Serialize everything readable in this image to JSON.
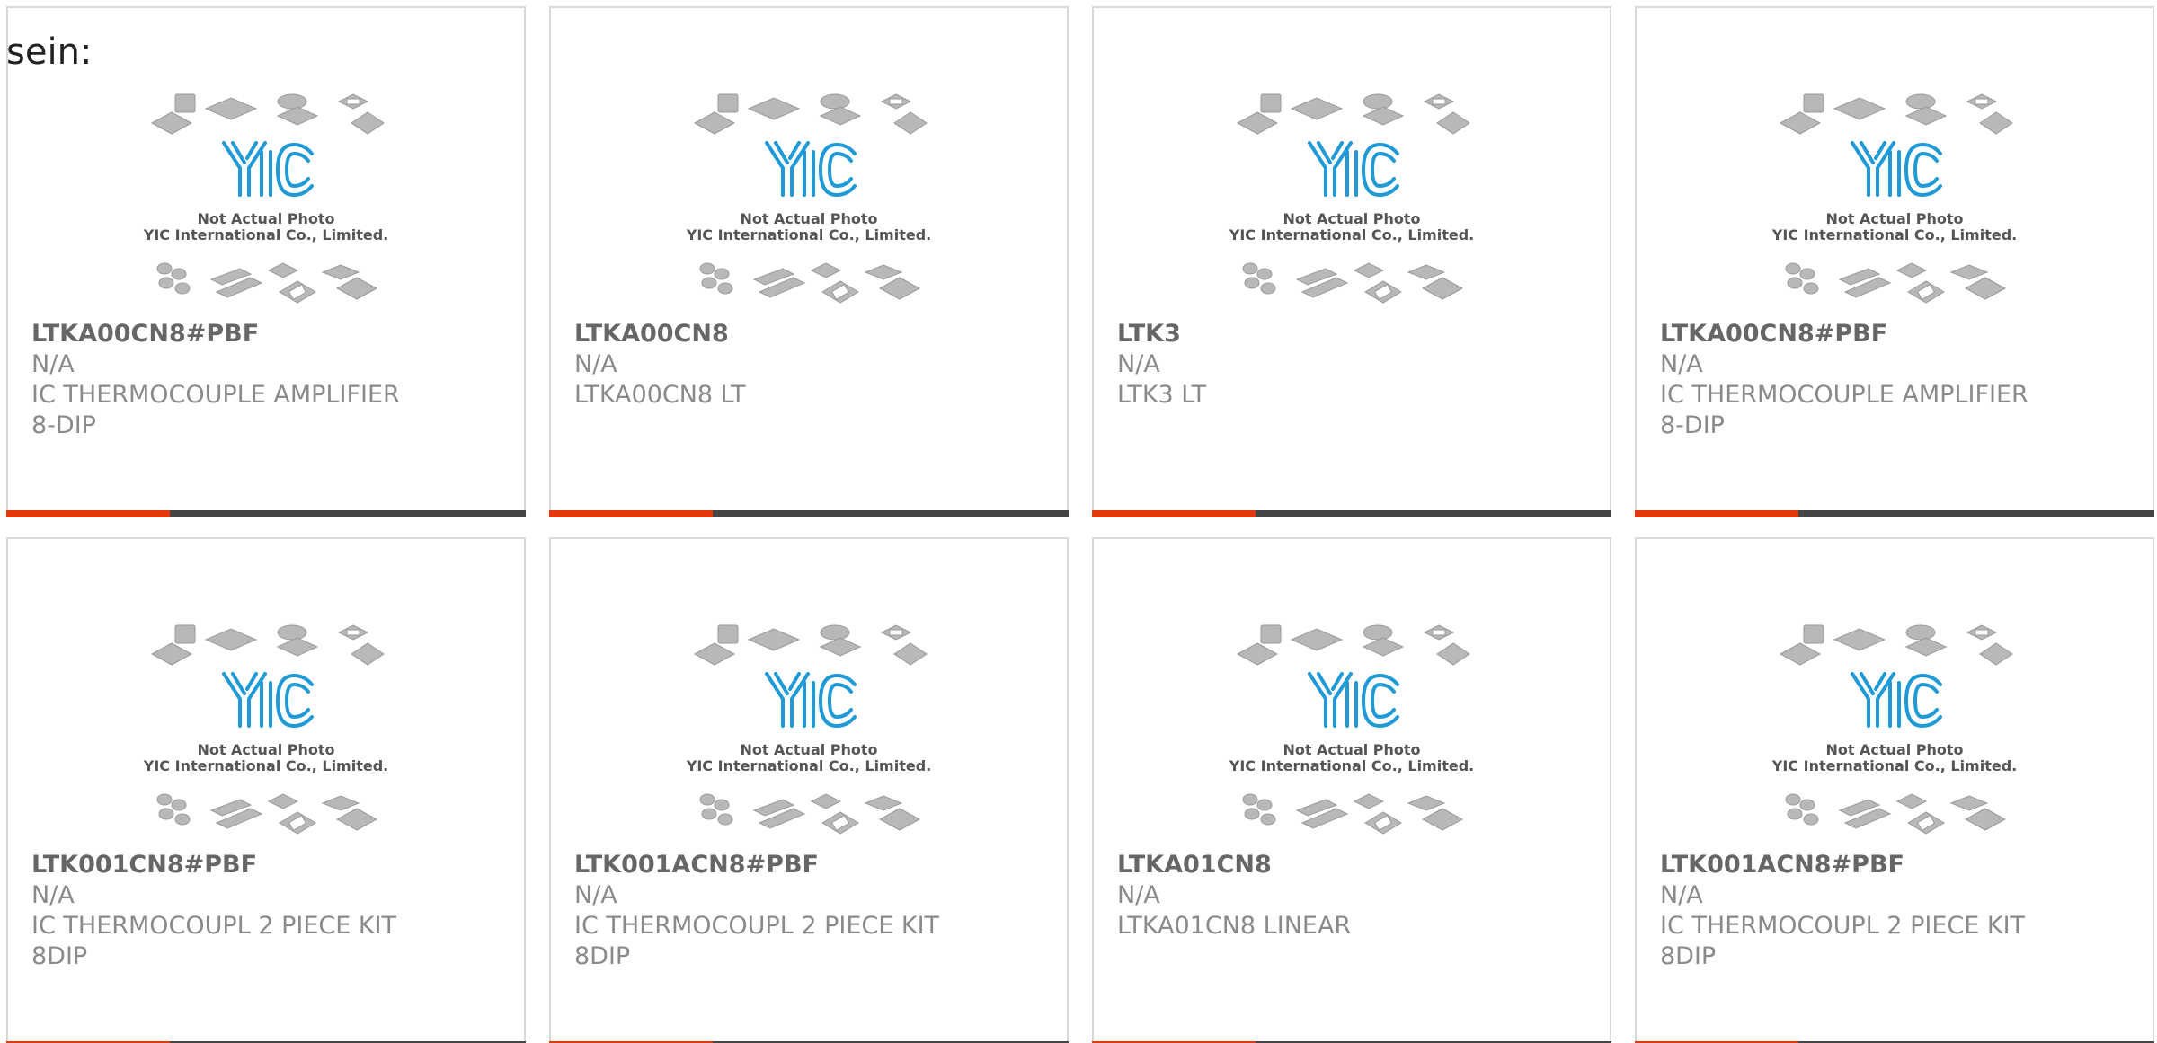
{
  "lead_text": "sein:",
  "accent_color": "#e5380f",
  "bar_color": "#454545",
  "placeholder": {
    "brand": "YIC",
    "line1": "Not Actual Photo",
    "line2": "YIC International Co., Limited."
  },
  "products": [
    {
      "part": "LTKA00CN8#PBF",
      "manufacturer": "N/A",
      "description": [
        "IC THERMOCOUPLE AMPLIFIER",
        "8-DIP"
      ]
    },
    {
      "part": "LTKA00CN8",
      "manufacturer": "N/A",
      "description": [
        "LTKA00CN8 LT"
      ]
    },
    {
      "part": "LTK3",
      "manufacturer": "N/A",
      "description": [
        "LTK3 LT"
      ]
    },
    {
      "part": "LTKA00CN8#PBF",
      "manufacturer": "N/A",
      "description": [
        "IC THERMOCOUPLE AMPLIFIER",
        "8-DIP"
      ]
    },
    {
      "part": "LTK001CN8#PBF",
      "manufacturer": "N/A",
      "description": [
        "IC THERMOCOUPL 2 PIECE KIT",
        "8DIP"
      ]
    },
    {
      "part": "LTK001ACN8#PBF",
      "manufacturer": "N/A",
      "description": [
        "IC THERMOCOUPL 2 PIECE KIT",
        "8DIP"
      ]
    },
    {
      "part": "LTKA01CN8",
      "manufacturer": "N/A",
      "description": [
        "LTKA01CN8 LINEAR"
      ]
    },
    {
      "part": "LTK001ACN8#PBF",
      "manufacturer": "N/A",
      "description": [
        "IC THERMOCOUPL 2 PIECE KIT",
        "8DIP"
      ]
    }
  ]
}
